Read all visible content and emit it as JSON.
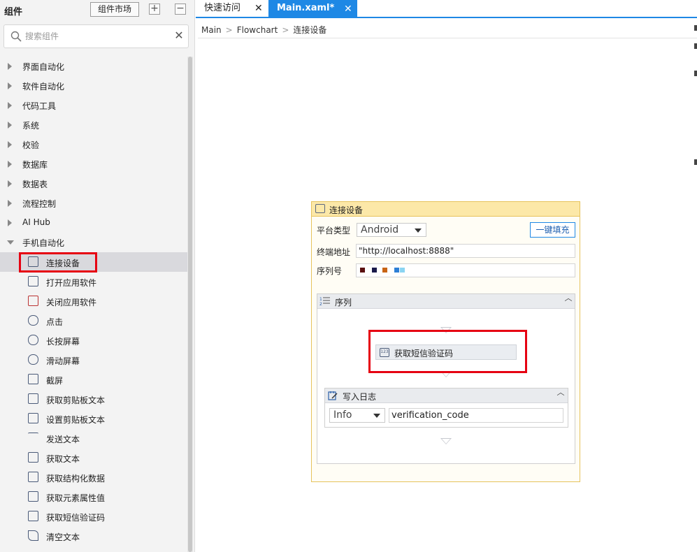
{
  "left_panel": {
    "title": "组件",
    "market_label": "组件市场",
    "expand_label": "+",
    "collapse_label": "−",
    "search": {
      "placeholder": "搜索组件",
      "clear_label": "✕"
    },
    "categories": [
      {
        "label": "界面自动化",
        "expanded": false
      },
      {
        "label": "软件自动化",
        "expanded": false
      },
      {
        "label": "代码工具",
        "expanded": false
      },
      {
        "label": "系统",
        "expanded": false
      },
      {
        "label": "校验",
        "expanded": false
      },
      {
        "label": "数据库",
        "expanded": false
      },
      {
        "label": "数据表",
        "expanded": false
      },
      {
        "label": "流程控制",
        "expanded": false
      },
      {
        "label": "AI Hub",
        "expanded": false
      },
      {
        "label": "手机自动化",
        "expanded": true
      }
    ],
    "mobile_items": [
      {
        "label": "连接设备",
        "icon": "connect-device-icon",
        "selected": true
      },
      {
        "label": "打开应用软件",
        "icon": "open-app-icon"
      },
      {
        "label": "关闭应用软件",
        "icon": "close-app-icon"
      },
      {
        "label": "点击",
        "icon": "tap-icon"
      },
      {
        "label": "长按屏幕",
        "icon": "long-press-icon"
      },
      {
        "label": "滑动屏幕",
        "icon": "swipe-icon"
      },
      {
        "label": "截屏",
        "icon": "screenshot-icon"
      },
      {
        "label": "获取剪贴板文本",
        "icon": "get-clipboard-icon"
      },
      {
        "label": "设置剪贴板文本",
        "icon": "set-clipboard-icon"
      },
      {
        "label": "发送文本",
        "icon": "send-text-icon"
      },
      {
        "label": "获取文本",
        "icon": "get-text-icon"
      },
      {
        "label": "获取结构化数据",
        "icon": "structured-data-icon"
      },
      {
        "label": "获取元素属性值",
        "icon": "element-attribute-icon"
      },
      {
        "label": "获取短信验证码",
        "icon": "sms-code-icon"
      },
      {
        "label": "清空文本",
        "icon": "clear-text-icon"
      }
    ]
  },
  "tabs": [
    {
      "label": "快速访问",
      "close": "✕",
      "active": false
    },
    {
      "label": "Main.xaml*",
      "close": "✕",
      "active": true
    }
  ],
  "breadcrumb": [
    "Main",
    "Flowchart",
    "连接设备"
  ],
  "breadcrumb_sep": ">",
  "activity": {
    "title": "连接设备",
    "platform_label": "平台类型",
    "platform_value": "Android",
    "fill_button": "一键填充",
    "address_label": "终端地址",
    "address_value": "\"http://localhost:8888\"",
    "serial_label": "序列号",
    "serial_colors": [
      "#5a1010",
      "#1a1a4a",
      "#c86414",
      "#2d7fd6",
      "#8ad4f2"
    ],
    "sequence": {
      "title": "序列",
      "collapse_label": "︿",
      "child_activity": "获取短信验证码",
      "log": {
        "title": "写入日志",
        "collapse_label": "︿",
        "level_value": "Info",
        "message_value": "verification_code"
      }
    }
  },
  "colors": {
    "accent": "#1e88e5",
    "highlight": "#e60012",
    "card_header": "#fce8a8",
    "card_border": "#e6c35c"
  }
}
